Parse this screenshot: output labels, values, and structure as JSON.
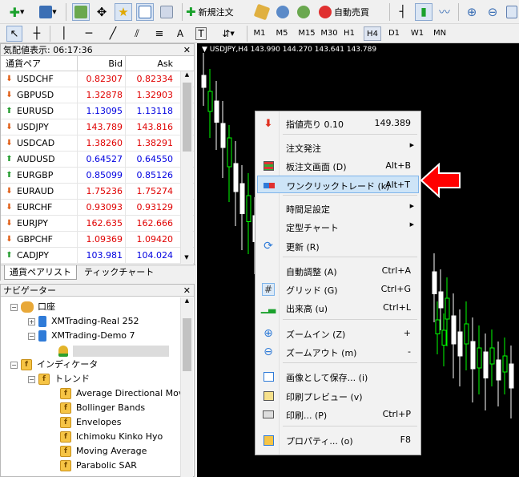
{
  "toolbar": {
    "new_order_label": "新規注文",
    "auto_trade_label": "自動売買",
    "timeframes": [
      "M1",
      "M5",
      "M15",
      "M30",
      "H1",
      "H4",
      "D1",
      "W1",
      "MN"
    ],
    "selected_timeframe": "H4"
  },
  "market_watch": {
    "title": "気配値表示: 06:17:36",
    "columns": {
      "symbol": "通貨ペア",
      "bid": "Bid",
      "ask": "Ask"
    },
    "rows": [
      {
        "symbol": "USDCHF",
        "bid": "0.82307",
        "ask": "0.82334",
        "dir": "down",
        "color": "red"
      },
      {
        "symbol": "GBPUSD",
        "bid": "1.32878",
        "ask": "1.32903",
        "dir": "down",
        "color": "red"
      },
      {
        "symbol": "EURUSD",
        "bid": "1.13095",
        "ask": "1.13118",
        "dir": "up",
        "color": "blue"
      },
      {
        "symbol": "USDJPY",
        "bid": "143.789",
        "ask": "143.816",
        "dir": "down",
        "color": "red"
      },
      {
        "symbol": "USDCAD",
        "bid": "1.38260",
        "ask": "1.38291",
        "dir": "down",
        "color": "red"
      },
      {
        "symbol": "AUDUSD",
        "bid": "0.64527",
        "ask": "0.64550",
        "dir": "up",
        "color": "blue"
      },
      {
        "symbol": "EURGBP",
        "bid": "0.85099",
        "ask": "0.85126",
        "dir": "up",
        "color": "blue"
      },
      {
        "symbol": "EURAUD",
        "bid": "1.75236",
        "ask": "1.75274",
        "dir": "down",
        "color": "red"
      },
      {
        "symbol": "EURCHF",
        "bid": "0.93093",
        "ask": "0.93129",
        "dir": "down",
        "color": "red"
      },
      {
        "symbol": "EURJPY",
        "bid": "162.635",
        "ask": "162.666",
        "dir": "down",
        "color": "red"
      },
      {
        "symbol": "GBPCHF",
        "bid": "1.09369",
        "ask": "1.09420",
        "dir": "down",
        "color": "red"
      },
      {
        "symbol": "CADJPY",
        "bid": "103.981",
        "ask": "104.024",
        "dir": "up",
        "color": "blue"
      }
    ],
    "tabs": [
      "通貨ペアリスト",
      "ティックチャート"
    ]
  },
  "navigator": {
    "title": "ナビゲーター",
    "account_root": "口座",
    "accounts": [
      "XMTrading-Real 252",
      "XMTrading-Demo 7"
    ],
    "indicators_root": "インディケータ",
    "trend_folder": "トレンド",
    "indicators": [
      "Average Directional Mov",
      "Bollinger Bands",
      "Envelopes",
      "Ichimoku Kinko Hyo",
      "Moving Average",
      "Parabolic SAR"
    ]
  },
  "chart": {
    "info": "▼ USDJPY,H4  143.990 144.270 143.641 143.789",
    "bull_color": "#00ff00",
    "bear_color": "#ffffff"
  },
  "context_menu": {
    "items": [
      {
        "label": "指値売り 0.10",
        "key": "149.389",
        "icon": "sell-arrow-icon"
      },
      {
        "label": "注文発注",
        "key": "",
        "submenu": true
      },
      {
        "label": "板注文画面 (D)",
        "key": "Alt+B",
        "icon": "depth-of-market-icon"
      },
      {
        "label": "ワンクリックトレード (k)",
        "key": "Alt+T",
        "icon": "one-click-trading-icon",
        "highlighted": true
      },
      {
        "label": "時間足設定",
        "key": "",
        "submenu": true
      },
      {
        "label": "定型チャート",
        "key": "",
        "submenu": true
      },
      {
        "label": "更新 (R)",
        "key": "",
        "icon": "refresh-icon"
      },
      {
        "label": "自動調整 (A)",
        "key": "Ctrl+A"
      },
      {
        "label": "グリッド (G)",
        "key": "Ctrl+G",
        "icon": "grid-icon"
      },
      {
        "label": "出来高 (u)",
        "key": "Ctrl+L",
        "icon": "volumes-icon"
      },
      {
        "label": "ズームイン (Z)",
        "key": "+",
        "icon": "zoom-in-icon"
      },
      {
        "label": "ズームアウト (m)",
        "key": "-",
        "icon": "zoom-out-icon"
      },
      {
        "label": "画像として保存... (i)",
        "key": "",
        "icon": "save-image-icon"
      },
      {
        "label": "印刷プレビュー (v)",
        "key": "",
        "icon": "print-preview-icon"
      },
      {
        "label": "印刷... (P)",
        "key": "Ctrl+P",
        "icon": "print-icon"
      },
      {
        "label": "プロパティ... (o)",
        "key": "F8",
        "icon": "properties-icon"
      }
    ]
  },
  "annotation": {
    "color": "#ff0000",
    "icon": "red-arrow-pointer-icon"
  }
}
